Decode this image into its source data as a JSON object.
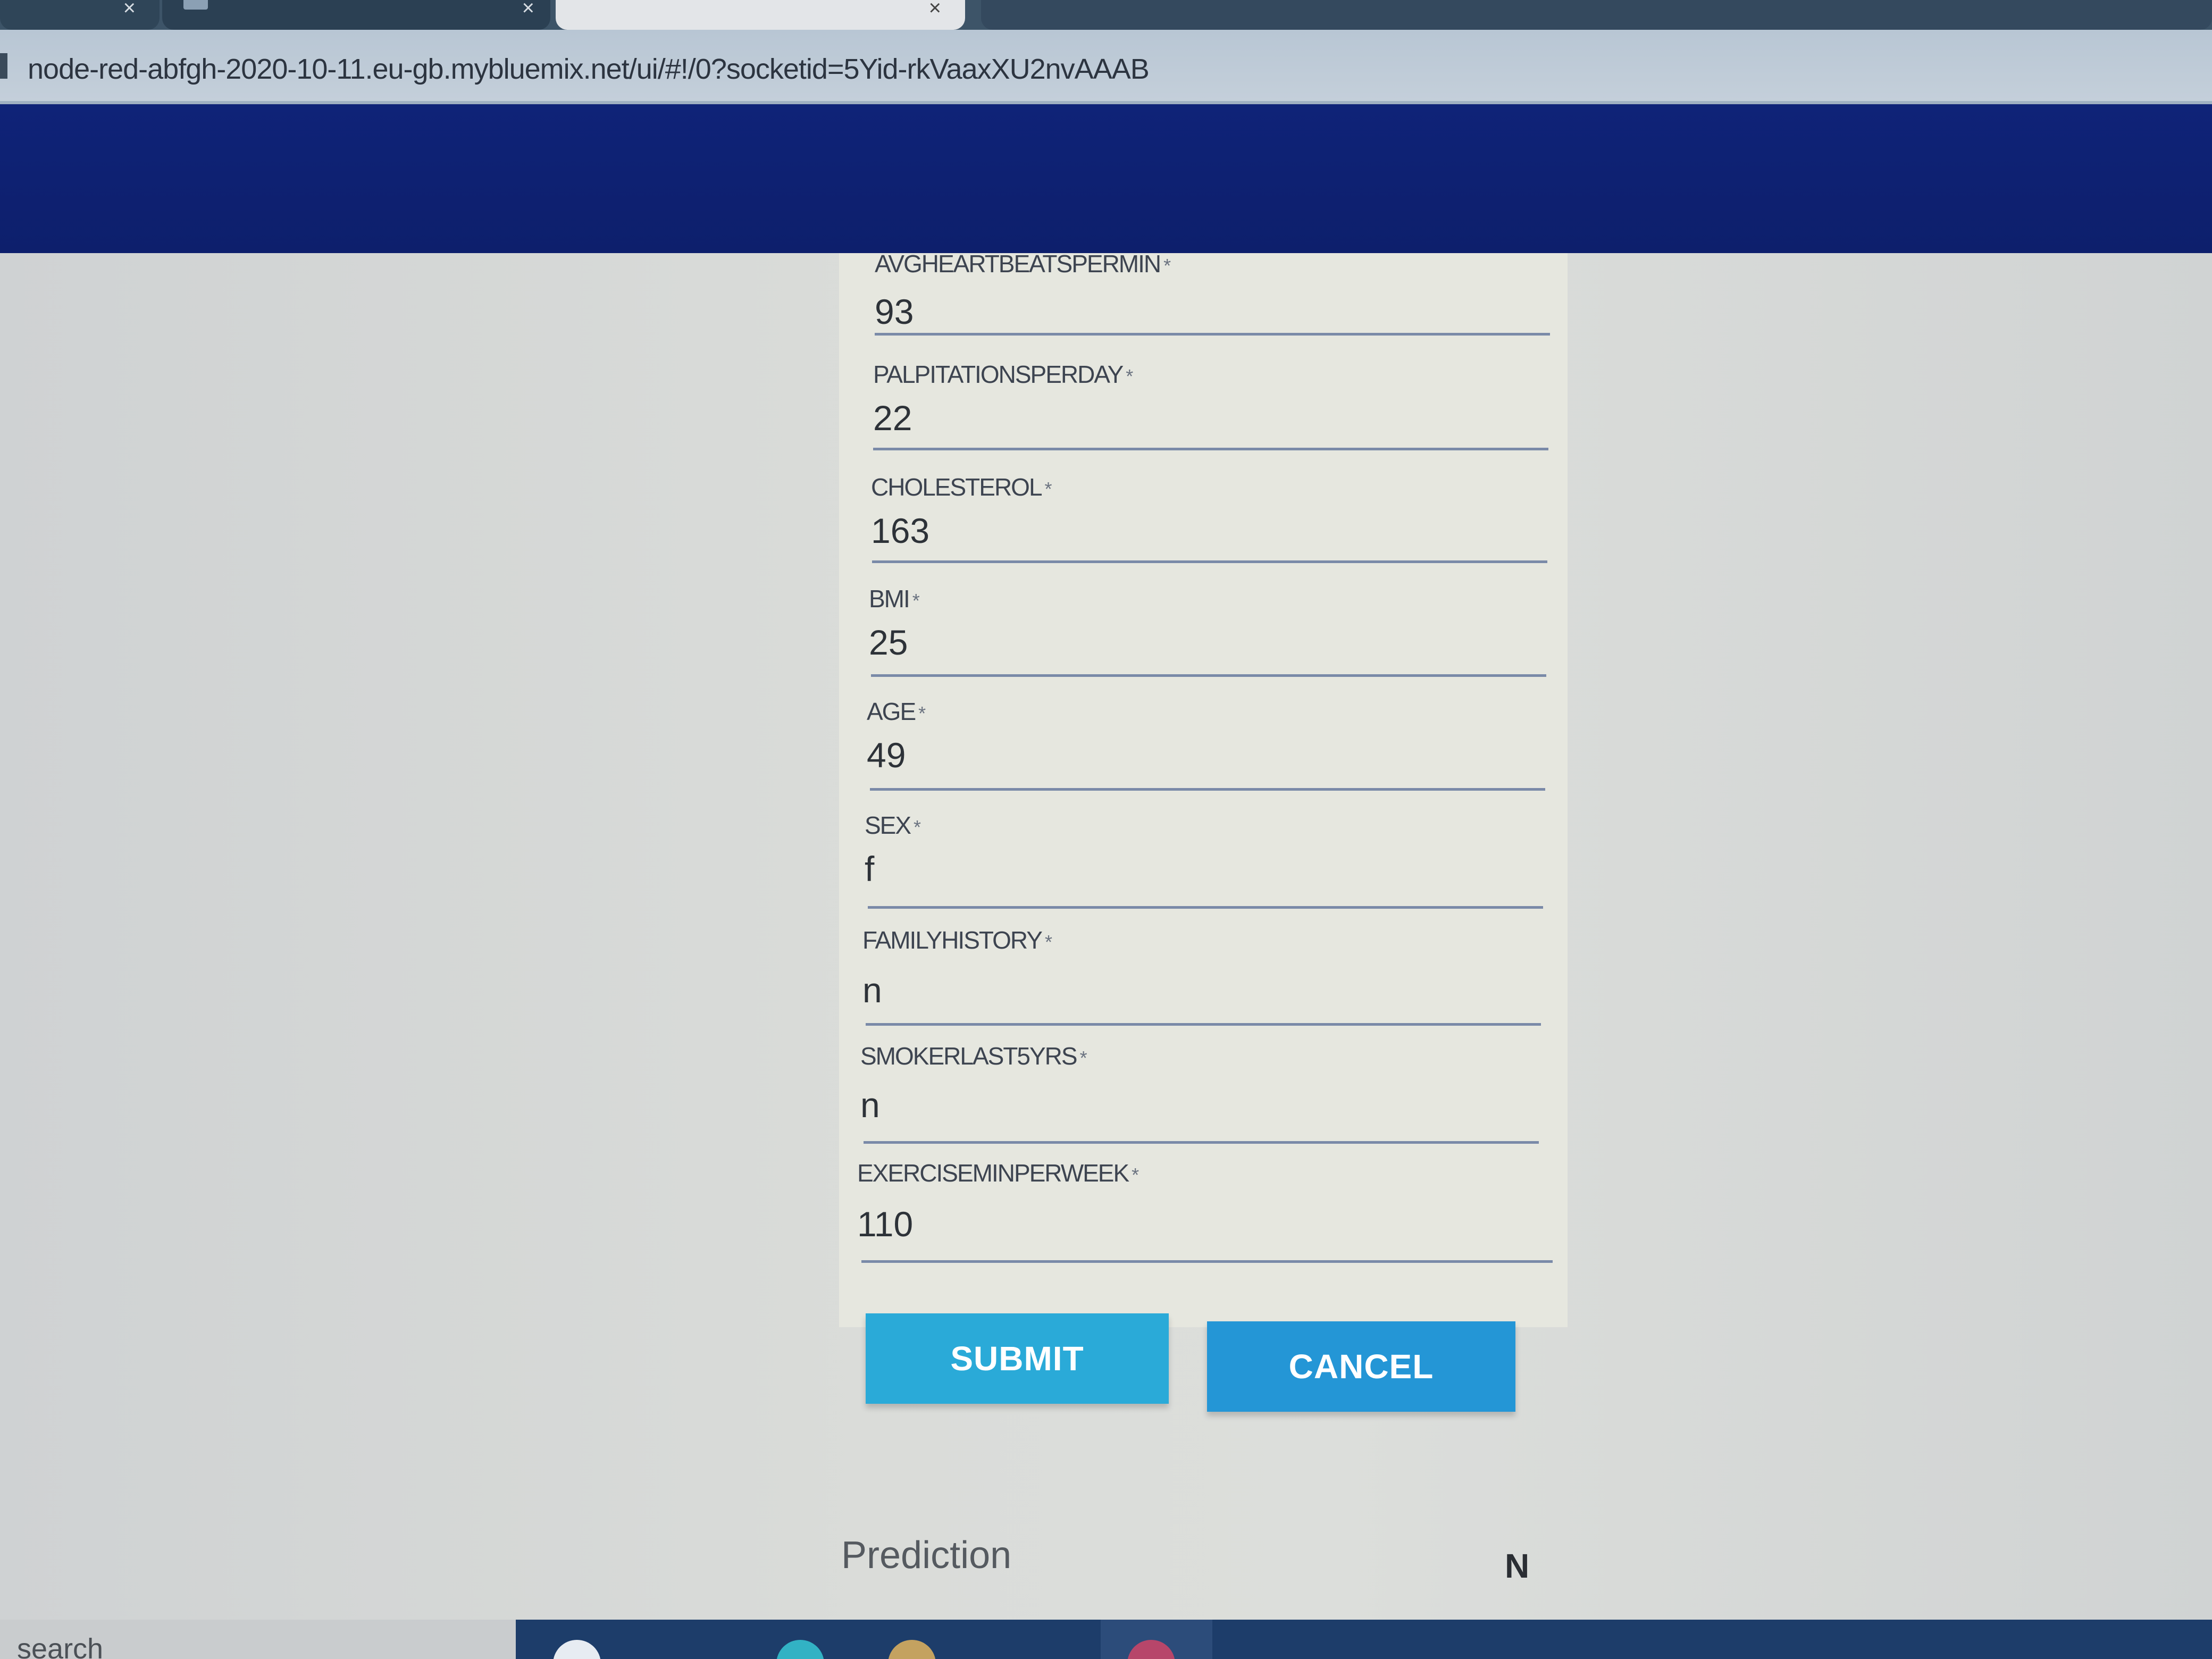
{
  "browser": {
    "tabs": [
      {
        "close_glyph": "×"
      },
      {
        "close_glyph": "×"
      },
      {
        "close_glyph": "×"
      },
      {}
    ],
    "url": "node-red-abfgh-2020-10-11.eu-gb.mybluemix.net/ui/#!/0?socketid=5Yid-rkVaaxXU2nvAAAB"
  },
  "form": {
    "required_marker": "*",
    "fields": [
      {
        "label": "AVGHEARTBEATSPERMIN",
        "value": "93"
      },
      {
        "label": "PALPITATIONSPERDAY",
        "value": "22"
      },
      {
        "label": "CHOLESTEROL",
        "value": "163"
      },
      {
        "label": "BMI",
        "value": "25"
      },
      {
        "label": "AGE",
        "value": "49"
      },
      {
        "label": "SEX",
        "value": "f"
      },
      {
        "label": "FAMILYHISTORY",
        "value": "n"
      },
      {
        "label": "SMOKERLAST5YRS",
        "value": "n"
      },
      {
        "label": "EXERCISEMINPERWEEK",
        "value": "110"
      }
    ],
    "submit_label": "SUBMIT",
    "cancel_label": "CANCEL"
  },
  "prediction": {
    "label": "Prediction",
    "value": "N"
  },
  "bottom": {
    "search_text": "search"
  },
  "colors": {
    "header": "#0f2378",
    "submit": "#2aaad8",
    "cancel": "#2496d6",
    "underline": "#7a8aa8"
  }
}
